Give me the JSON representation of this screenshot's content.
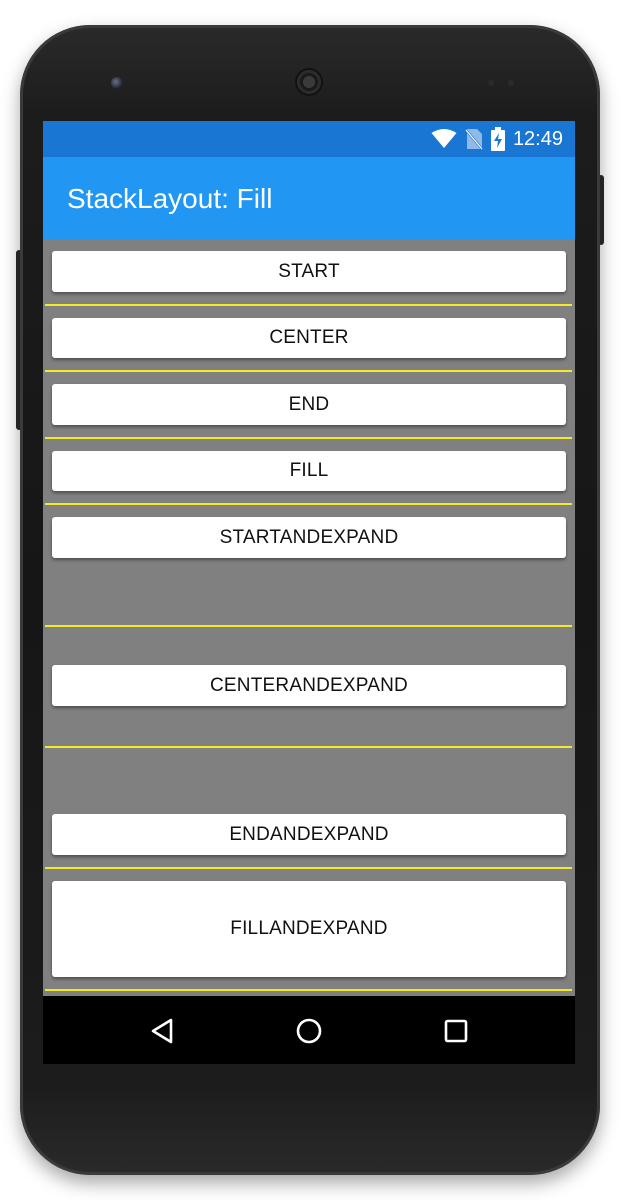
{
  "status_bar": {
    "time": "12:49",
    "icons": [
      "wifi-icon",
      "no-sim-icon",
      "battery-charging-icon"
    ]
  },
  "app_bar": {
    "title": "StackLayout: Fill"
  },
  "buttons": {
    "start": "START",
    "center": "CENTER",
    "end": "END",
    "fill": "FILL",
    "start_and_expand": "STARTANDEXPAND",
    "center_and_expand": "CENTERANDEXPAND",
    "end_and_expand": "ENDANDEXPAND",
    "fill_and_expand": "FILLANDEXPAND"
  },
  "navigation": {
    "icons": [
      "back-icon",
      "home-icon",
      "recents-icon"
    ]
  },
  "colors": {
    "status_bar": "#1976d2",
    "app_bar": "#2196f3",
    "content_background": "#808080",
    "separator": "#f2ea28",
    "button_background": "#ffffff",
    "nav_bar": "#000000"
  }
}
